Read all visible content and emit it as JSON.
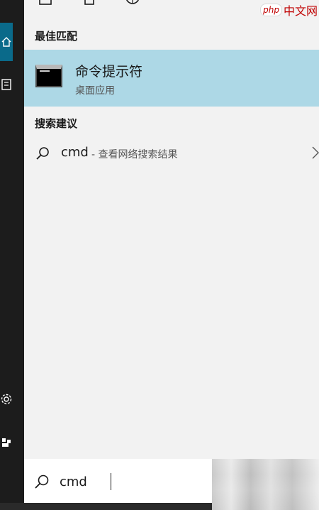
{
  "watermark": {
    "badge": "php",
    "text": "中文网"
  },
  "best_match": {
    "section_title": "最佳匹配",
    "app_name": "命令提示符",
    "app_type": "桌面应用",
    "icon": "command-prompt-icon"
  },
  "suggestions": {
    "section_title": "搜索建议",
    "items": [
      {
        "query": "cmd",
        "description": "- 查看网络搜索结果",
        "icon": "search-icon"
      }
    ]
  },
  "search": {
    "value": "cmd",
    "icon": "search-icon"
  },
  "sidebar": {
    "icons": [
      "home-icon",
      "document-icon",
      "settings-icon",
      "user-icon"
    ]
  },
  "top_icons": [
    "document-icon",
    "app-icon",
    "globe-icon"
  ],
  "colors": {
    "sidebar": "#1c1c1c",
    "accent": "#0a6a8a",
    "panel": "#f2f2f2",
    "selection": "#add8e6"
  }
}
